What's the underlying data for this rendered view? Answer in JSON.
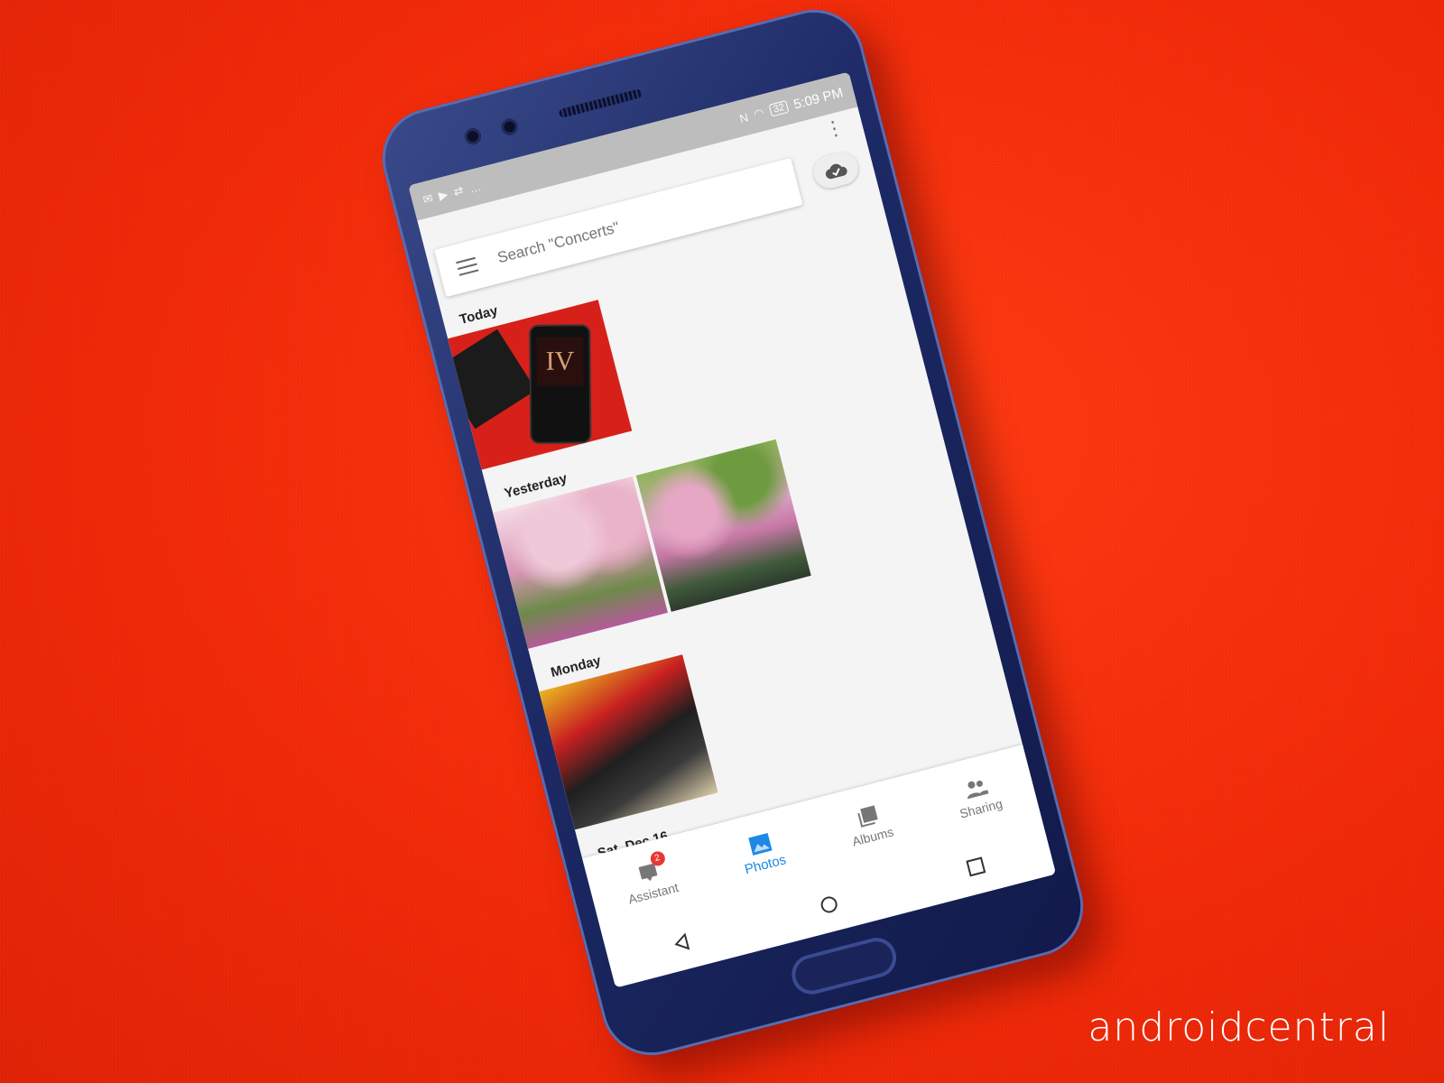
{
  "status_bar": {
    "time": "5:09 PM",
    "battery": "32"
  },
  "search": {
    "placeholder": "Search \"Concerts\""
  },
  "sections": [
    {
      "label": "Today"
    },
    {
      "label": "Yesterday"
    },
    {
      "label": "Monday"
    },
    {
      "label": "Sat, Dec 16"
    }
  ],
  "today_photo": {
    "screen_text": "IV"
  },
  "bottom_nav": {
    "items": [
      {
        "label": "Assistant",
        "icon": "assistant-icon",
        "badge": "2"
      },
      {
        "label": "Photos",
        "icon": "photos-icon",
        "active": true
      },
      {
        "label": "Albums",
        "icon": "albums-icon"
      },
      {
        "label": "Sharing",
        "icon": "sharing-icon"
      }
    ]
  },
  "system_nav": {
    "icons": [
      "back-icon",
      "home-icon",
      "recents-icon"
    ]
  },
  "watermark": "androidcentral",
  "colors": {
    "accent": "#1e88e5",
    "background": "#f22a08",
    "badge": "#e53935"
  }
}
